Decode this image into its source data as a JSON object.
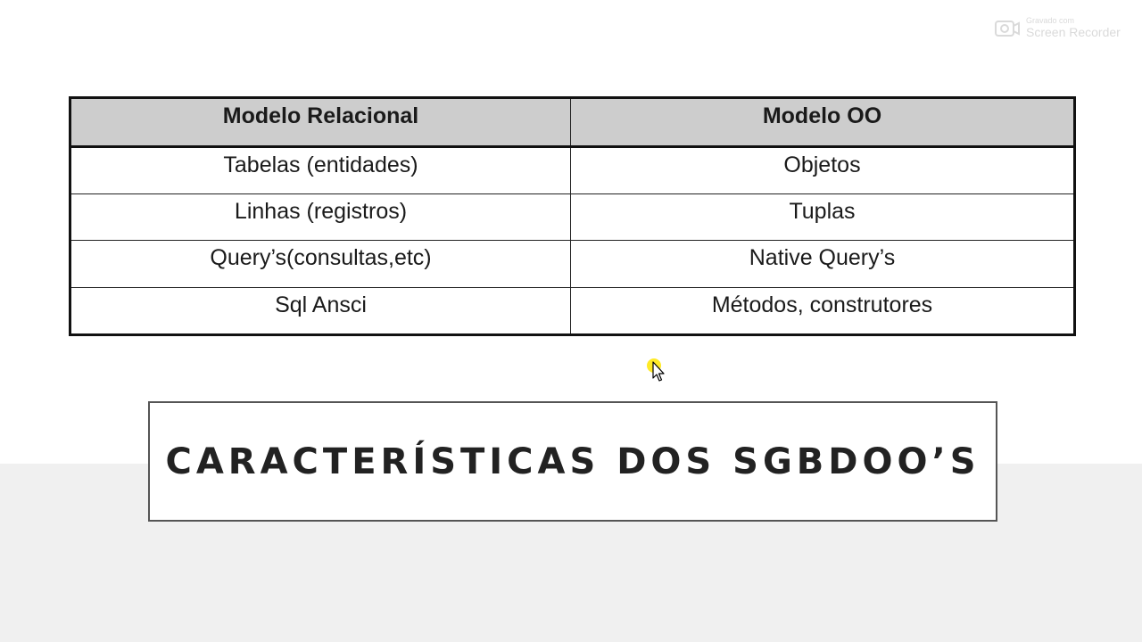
{
  "watermark": {
    "small_text": "Gravado com",
    "brand_text": "Screen Recorder",
    "icon": "recorder-icon"
  },
  "table": {
    "headers": [
      "Modelo Relacional",
      "Modelo OO"
    ],
    "rows": [
      [
        "Tabelas (entidades)",
        "Objetos"
      ],
      [
        "Linhas (registros)",
        "Tuplas"
      ],
      [
        "Query’s(consultas,etc)",
        "Native Query’s"
      ],
      [
        "Sql Ansci",
        "Métodos, construtores"
      ]
    ]
  },
  "slide": {
    "title": "CARACTERÍSTICAS DOS SGBDOO’S"
  },
  "colors": {
    "header_bg": "#cdcdcd",
    "band_bg": "#f0f0f0",
    "cursor_highlight": "#ffe600"
  },
  "cursor": {
    "icon": "mouse-pointer-icon"
  }
}
